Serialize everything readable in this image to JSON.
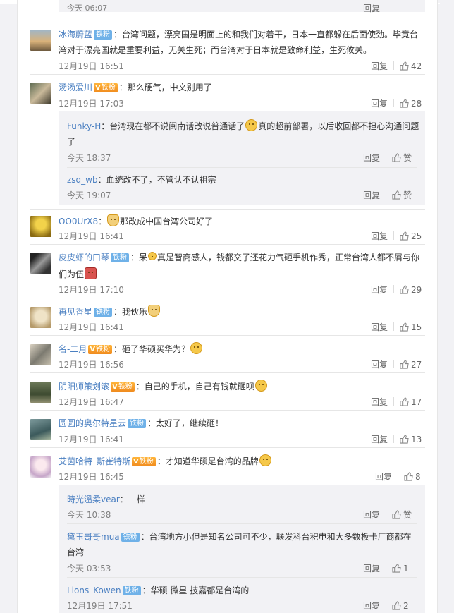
{
  "top_partial": {
    "time": "今天 06:07",
    "reply": "回复"
  },
  "ui": {
    "reply": "回复",
    "like": "赞",
    "iron_badge": "铁粉",
    "gold_badge": "铁粉"
  },
  "comments": [
    {
      "user": "冰海蔚蓝",
      "text1": "：台湾问题，漂亮国是明面上的和我们对着干，日本一直都躲在后面使劲。毕竟台",
      "text2": "湾对于漂亮国就是重要利益，无关生死；而台湾对于日本就是致命利益，生死攸关。",
      "time": "12月19日 16:51",
      "likes": "42"
    },
    {
      "user": "汤汤爱川",
      "text1": "：那么硬气，中文别用了",
      "time": "12月19日 17:03",
      "likes": "28"
    },
    {
      "user": "OO0UrX8",
      "text1": "：",
      "text1b": "那改成中国台湾公司好了",
      "time": "12月19日 16:41",
      "likes": "25"
    },
    {
      "user": "皮皮虾的口琴",
      "text1": "：呆",
      "text1b": "真是智商感人，钱都交了还花力气砸手机作秀，正常台湾人都不屑与你",
      "text2": "们为伍",
      "time": "12月19日 17:10",
      "likes": "29"
    },
    {
      "user": "再见香星",
      "text1": "：我伙乐",
      "time": "12月19日 16:41",
      "likes": "15"
    },
    {
      "user": "名-二月",
      "text1": "：砸了华硕买华为？",
      "time": "12月19日 16:56",
      "likes": "27"
    },
    {
      "user": "阴阳师策划滚",
      "text1": "：自己的手机，自己有钱就砸呗",
      "time": "12月19日 16:47",
      "likes": "17"
    },
    {
      "user": "圆圆的奥尔特星云",
      "text1": "：太好了，继续砸！",
      "time": "12月19日 16:41",
      "likes": "13"
    },
    {
      "user": "艾茵哈特_斯崔特斯",
      "text1": "：才知道华硕是台湾的品牌",
      "time": "12月19日 16:45",
      "likes": "8"
    }
  ],
  "replies_a": [
    {
      "user": "Funky-H",
      "text1": "：台湾现在都不说闽南话改说普通话了",
      "text1b": "真的超前部署，以后收回都不担心沟通问题",
      "text2": "了",
      "time": "今天 18:37",
      "likes": "赞"
    },
    {
      "user": "zsq_wb",
      "text1": "：血统改不了，不管认不认祖宗",
      "time": "今天 19:07",
      "likes": "赞"
    }
  ],
  "replies_b": [
    {
      "user": "時光溫柔vear",
      "text1": "：一样",
      "time": "今天 10:38",
      "likes": "赞"
    },
    {
      "user": "黛玉哥哥mua",
      "text1": "：台湾地方小但是知名公司可不少，联发科台积电和大多数板卡厂商都在",
      "text2": "台湾",
      "time": "今天 03:53",
      "likes": "1"
    },
    {
      "user": "Lions_Kowen",
      "text1": "：华硕 微星 技嘉都是台湾的",
      "time": "12月19日 17:51",
      "likes": "2"
    }
  ]
}
